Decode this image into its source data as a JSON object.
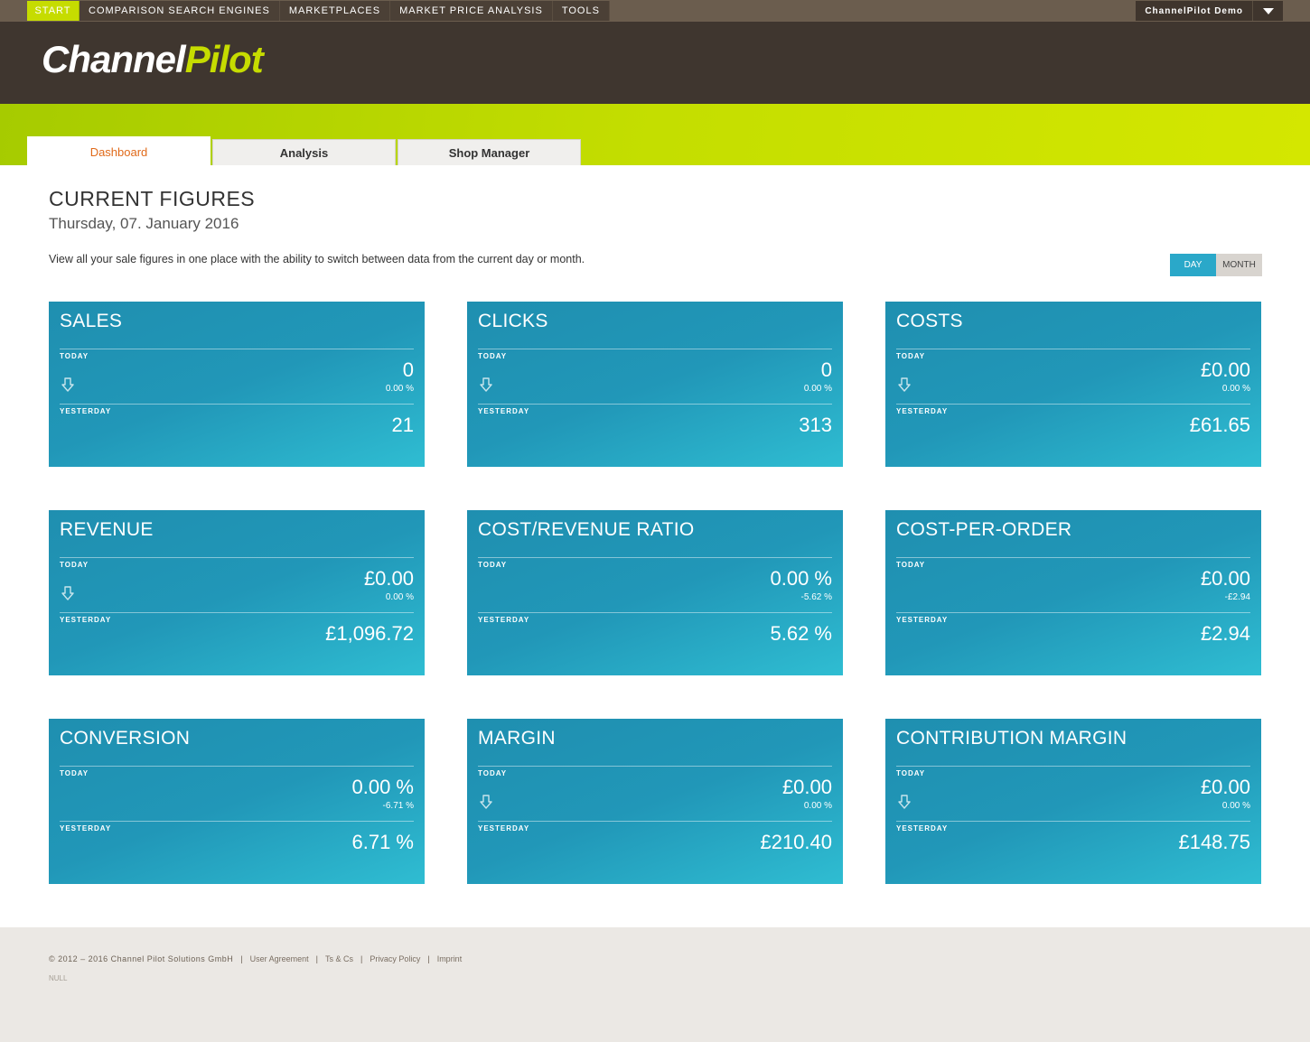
{
  "nav": {
    "start": "START",
    "items": [
      "COMPARISON SEARCH ENGINES",
      "MARKETPLACES",
      "MARKET PRICE ANALYSIS",
      "TOOLS"
    ],
    "user": "ChannelPilot Demo"
  },
  "logo": {
    "part1": "Channel",
    "part2": "Pilot"
  },
  "tabs": [
    "Dashboard",
    "Analysis",
    "Shop Manager"
  ],
  "main": {
    "title": "CURRENT FIGURES",
    "date": "Thursday, 07. January 2016",
    "description": "View all your sale figures in one place with the ability to switch between data from the current day or month.",
    "toggle": {
      "day": "DAY",
      "month": "MONTH"
    }
  },
  "labels": {
    "today": "TODAY",
    "yesterday": "YESTERDAY"
  },
  "cards": [
    {
      "title": "SALES",
      "today": "0",
      "change": "0.00  %",
      "yesterday": "21",
      "arrow": true
    },
    {
      "title": "CLICKS",
      "today": "0",
      "change": "0.00  %",
      "yesterday": "313",
      "arrow": true
    },
    {
      "title": "COSTS",
      "today": "£0.00",
      "change": "0.00  %",
      "yesterday": "£61.65",
      "arrow": true
    },
    {
      "title": "REVENUE",
      "today": "£0.00",
      "change": "0.00  %",
      "yesterday": "£1,096.72",
      "arrow": true
    },
    {
      "title": "COST/REVENUE RATIO",
      "today": "0.00 %",
      "change": "-5.62  %",
      "yesterday": "5.62 %",
      "arrow": false
    },
    {
      "title": "COST-PER-ORDER",
      "today": "£0.00",
      "change": "-£2.94",
      "yesterday": "£2.94",
      "arrow": false
    },
    {
      "title": "CONVERSION",
      "today": "0.00 %",
      "change": "-6.71  %",
      "yesterday": "6.71 %",
      "arrow": false
    },
    {
      "title": "MARGIN",
      "today": "£0.00",
      "change": "0.00  %",
      "yesterday": "£210.40",
      "arrow": true
    },
    {
      "title": "CONTRIBUTION MARGIN",
      "today": "£0.00",
      "change": "0.00  %",
      "yesterday": "£148.75",
      "arrow": true
    }
  ],
  "footer": {
    "copyright": "© 2012 – 2016 Channel Pilot Solutions GmbH",
    "links": [
      "User Agreement",
      "Ts & Cs",
      "Privacy Policy",
      "Imprint"
    ],
    "null_text": "NULL"
  },
  "colors": {
    "accent_green": "#c6dc00",
    "card_blue": "#2197b8",
    "tab_active_text": "#e06a1a"
  }
}
